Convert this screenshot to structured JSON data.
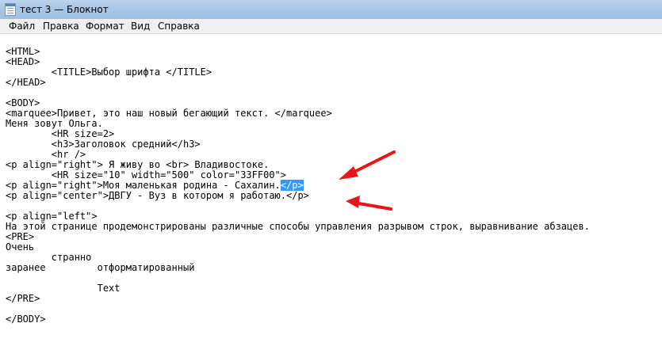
{
  "window": {
    "title": "тест 3 — Блокнот"
  },
  "menu": {
    "items": [
      "Файл",
      "Правка",
      "Формат",
      "Вид",
      "Справка"
    ]
  },
  "editor": {
    "lines": [
      "",
      "<HTML>",
      "<HEAD>",
      "        <TITLE>Выбор шрифта </TITLE>",
      "</HEAD>",
      "",
      "<BODY>",
      "<marquee>Привет, это наш новый бегающий текст. </marquee>",
      "Меня зовут Ольга.",
      "        <HR size=2>",
      "        <h3>Заголовок средний</h3>",
      "        <hr />",
      "<p align=\"right\"> Я живу во <br> Владивостоке.",
      "        <HR size=\"10\" width=\"500\" color=\"33FF00\">",
      "<p align=\"right\">Моя маленькая родина - Сахалин.</p>",
      "<p align=\"center\">ДВГУ - Вуз в котором я работаю.</p>",
      "",
      "<p align=\"left\">",
      "На этой странице продемонстрированы различные способы управления разрывом строк, выравнивание абзацев.",
      "<PRE>",
      "Очень",
      "        странно",
      "заранее         отформатированный",
      "",
      "                Text",
      "</PRE>",
      "",
      "</BODY>"
    ],
    "selection": {
      "line": 14,
      "before": "<p align=\"right\">Моя маленькая родина - Сахалин.",
      "selected": "</p>"
    }
  },
  "colors": {
    "selection": "#3399ff",
    "arrow": "#e8161b",
    "titlebar": "#a9c6e6",
    "menubar": "#f0f0f0"
  }
}
